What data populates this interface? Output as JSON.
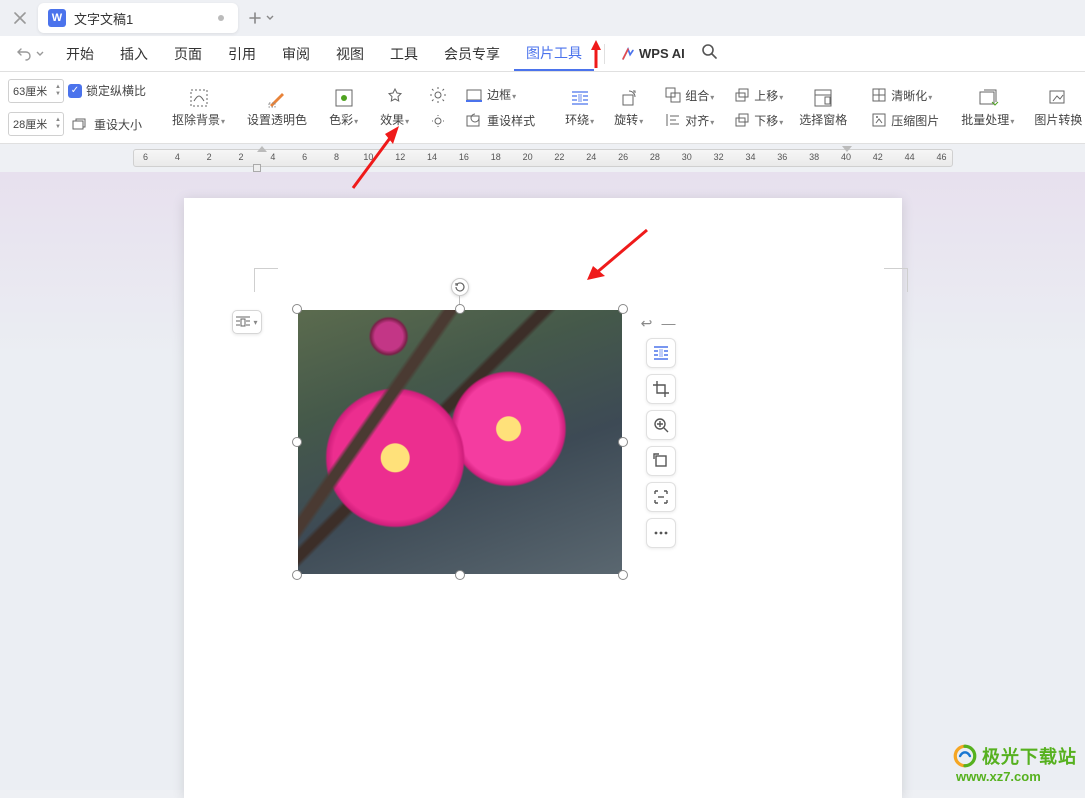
{
  "tab": {
    "icon_letter": "W",
    "title": "文字文稿1"
  },
  "menu": {
    "items": [
      "开始",
      "插入",
      "页面",
      "引用",
      "审阅",
      "视图",
      "工具",
      "会员专享",
      "图片工具"
    ],
    "active_index": 8,
    "wps_ai": "WPS AI"
  },
  "ribbon": {
    "size": {
      "height": "63厘米",
      "width": "28厘米",
      "lock_ratio": "锁定纵横比",
      "reset_size": "重设大小"
    },
    "remove_bg": "抠除背景",
    "set_transparent": "设置透明色",
    "color": "色彩",
    "effect": "效果",
    "border": "边框",
    "reset_style": "重设样式",
    "wrap": "环绕",
    "rotate": "旋转",
    "group": "组合",
    "align": "对齐",
    "move_up": "上移",
    "move_down": "下移",
    "selection_pane": "选择窗格",
    "clarity": "清晰化",
    "compress": "压缩图片",
    "batch": "批量处理",
    "convert": "图片转换"
  },
  "ruler": {
    "numbers": [
      6,
      4,
      2,
      2,
      4,
      6,
      8,
      10,
      12,
      14,
      16,
      18,
      20,
      22,
      24,
      26,
      28,
      30,
      32,
      34,
      36,
      38,
      40,
      42,
      44,
      46
    ]
  },
  "float_tools": {
    "top_arrow": "↩",
    "top_minus": "—"
  },
  "watermark": {
    "name": "极光下载站",
    "url": "www.xz7.com"
  }
}
